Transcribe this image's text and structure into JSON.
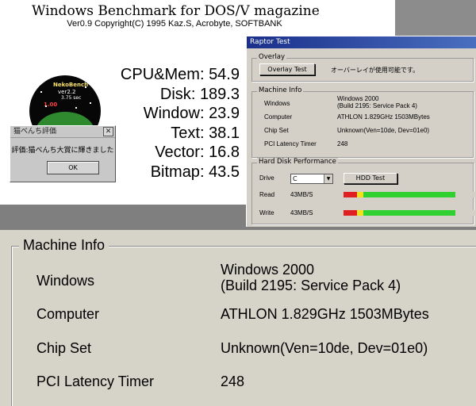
{
  "app": {
    "title": "Windows Benchmark for DOS/V magazine",
    "subtitle": "Ver0.9 Copyright(C) 1995 Kaz.S, Acrobyte, SOFTBANK"
  },
  "logo": {
    "name": "NekoBench",
    "version": "ver2.2",
    "line3": "3.75 sec",
    "line4": "1.00"
  },
  "scores": [
    {
      "label": "CPU&Mem",
      "value": "54.9"
    },
    {
      "label": "Disk",
      "value": "189.3"
    },
    {
      "label": "Window",
      "value": "23.9"
    },
    {
      "label": "Text",
      "value": "38.1"
    },
    {
      "label": "Vector",
      "value": "16.8"
    },
    {
      "label": "Bitmap",
      "value": "43.5"
    }
  ],
  "dialog": {
    "title": "猫べんち評価",
    "message": "評価:猫べんち大賞に輝きました",
    "ok_label": "OK",
    "close_glyph": "✕"
  },
  "raptor": {
    "title": "Raptor Test",
    "overlay": {
      "legend": "Overlay",
      "button_label": "Overlay Test",
      "status": "オーバーレイが使用可能です。"
    },
    "machine_info": {
      "legend": "Machine Info",
      "rows": [
        {
          "label": "Windows",
          "value": "Windows 2000",
          "value2": "(Build 2195: Service Pack 4)"
        },
        {
          "label": "Computer",
          "value": "ATHLON 1.829GHz 1503MBytes"
        },
        {
          "label": "Chip Set",
          "value": "Unknown(Ven=10de, Dev=01e0)"
        },
        {
          "label": "PCI Latency Timer",
          "value": "248"
        }
      ]
    },
    "hdd": {
      "legend": "Hard Disk Performance",
      "drive_label": "Drive",
      "drive_value": "C",
      "button_label": "HDD Test",
      "read_label": "Read",
      "read_value": "43MB/S",
      "write_label": "Write",
      "write_value": "43MB/S",
      "read_level": 0.85,
      "write_level": 0.85,
      "colors": {
        "red": "#e02020",
        "yellow": "#f0e020",
        "green": "#30d030"
      }
    }
  },
  "zoom": {
    "legend": "Machine Info",
    "rows": [
      {
        "label": "Windows",
        "value": "Windows 2000",
        "value2": "(Build 2195: Service Pack 4)"
      },
      {
        "label": "Computer",
        "value": "ATHLON 1.829GHz 1503MBytes"
      },
      {
        "label": "Chip Set",
        "value": "Unknown(Ven=10de, Dev=01e0)"
      },
      {
        "label": "PCI Latency Timer",
        "value": "248"
      }
    ]
  }
}
